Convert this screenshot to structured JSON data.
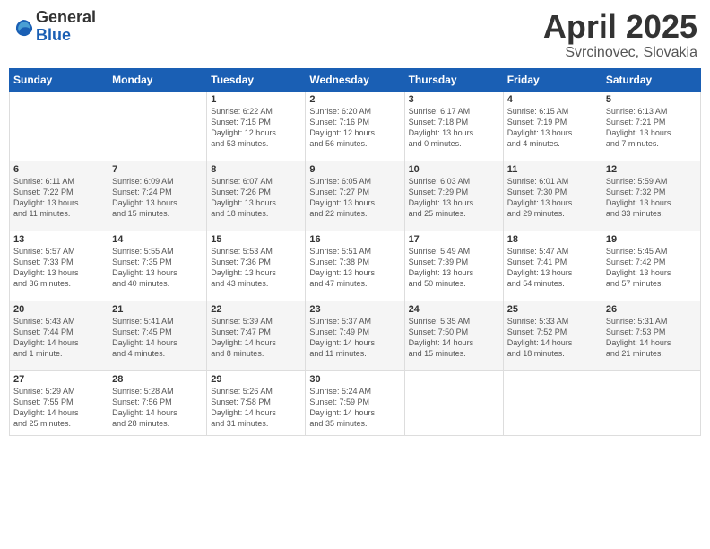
{
  "header": {
    "logo_general": "General",
    "logo_blue": "Blue",
    "month_title": "April 2025",
    "location": "Svrcinovec, Slovakia"
  },
  "weekdays": [
    "Sunday",
    "Monday",
    "Tuesday",
    "Wednesday",
    "Thursday",
    "Friday",
    "Saturday"
  ],
  "weeks": [
    [
      {
        "day": "",
        "info": ""
      },
      {
        "day": "",
        "info": ""
      },
      {
        "day": "1",
        "info": "Sunrise: 6:22 AM\nSunset: 7:15 PM\nDaylight: 12 hours\nand 53 minutes."
      },
      {
        "day": "2",
        "info": "Sunrise: 6:20 AM\nSunset: 7:16 PM\nDaylight: 12 hours\nand 56 minutes."
      },
      {
        "day": "3",
        "info": "Sunrise: 6:17 AM\nSunset: 7:18 PM\nDaylight: 13 hours\nand 0 minutes."
      },
      {
        "day": "4",
        "info": "Sunrise: 6:15 AM\nSunset: 7:19 PM\nDaylight: 13 hours\nand 4 minutes."
      },
      {
        "day": "5",
        "info": "Sunrise: 6:13 AM\nSunset: 7:21 PM\nDaylight: 13 hours\nand 7 minutes."
      }
    ],
    [
      {
        "day": "6",
        "info": "Sunrise: 6:11 AM\nSunset: 7:22 PM\nDaylight: 13 hours\nand 11 minutes."
      },
      {
        "day": "7",
        "info": "Sunrise: 6:09 AM\nSunset: 7:24 PM\nDaylight: 13 hours\nand 15 minutes."
      },
      {
        "day": "8",
        "info": "Sunrise: 6:07 AM\nSunset: 7:26 PM\nDaylight: 13 hours\nand 18 minutes."
      },
      {
        "day": "9",
        "info": "Sunrise: 6:05 AM\nSunset: 7:27 PM\nDaylight: 13 hours\nand 22 minutes."
      },
      {
        "day": "10",
        "info": "Sunrise: 6:03 AM\nSunset: 7:29 PM\nDaylight: 13 hours\nand 25 minutes."
      },
      {
        "day": "11",
        "info": "Sunrise: 6:01 AM\nSunset: 7:30 PM\nDaylight: 13 hours\nand 29 minutes."
      },
      {
        "day": "12",
        "info": "Sunrise: 5:59 AM\nSunset: 7:32 PM\nDaylight: 13 hours\nand 33 minutes."
      }
    ],
    [
      {
        "day": "13",
        "info": "Sunrise: 5:57 AM\nSunset: 7:33 PM\nDaylight: 13 hours\nand 36 minutes."
      },
      {
        "day": "14",
        "info": "Sunrise: 5:55 AM\nSunset: 7:35 PM\nDaylight: 13 hours\nand 40 minutes."
      },
      {
        "day": "15",
        "info": "Sunrise: 5:53 AM\nSunset: 7:36 PM\nDaylight: 13 hours\nand 43 minutes."
      },
      {
        "day": "16",
        "info": "Sunrise: 5:51 AM\nSunset: 7:38 PM\nDaylight: 13 hours\nand 47 minutes."
      },
      {
        "day": "17",
        "info": "Sunrise: 5:49 AM\nSunset: 7:39 PM\nDaylight: 13 hours\nand 50 minutes."
      },
      {
        "day": "18",
        "info": "Sunrise: 5:47 AM\nSunset: 7:41 PM\nDaylight: 13 hours\nand 54 minutes."
      },
      {
        "day": "19",
        "info": "Sunrise: 5:45 AM\nSunset: 7:42 PM\nDaylight: 13 hours\nand 57 minutes."
      }
    ],
    [
      {
        "day": "20",
        "info": "Sunrise: 5:43 AM\nSunset: 7:44 PM\nDaylight: 14 hours\nand 1 minute."
      },
      {
        "day": "21",
        "info": "Sunrise: 5:41 AM\nSunset: 7:45 PM\nDaylight: 14 hours\nand 4 minutes."
      },
      {
        "day": "22",
        "info": "Sunrise: 5:39 AM\nSunset: 7:47 PM\nDaylight: 14 hours\nand 8 minutes."
      },
      {
        "day": "23",
        "info": "Sunrise: 5:37 AM\nSunset: 7:49 PM\nDaylight: 14 hours\nand 11 minutes."
      },
      {
        "day": "24",
        "info": "Sunrise: 5:35 AM\nSunset: 7:50 PM\nDaylight: 14 hours\nand 15 minutes."
      },
      {
        "day": "25",
        "info": "Sunrise: 5:33 AM\nSunset: 7:52 PM\nDaylight: 14 hours\nand 18 minutes."
      },
      {
        "day": "26",
        "info": "Sunrise: 5:31 AM\nSunset: 7:53 PM\nDaylight: 14 hours\nand 21 minutes."
      }
    ],
    [
      {
        "day": "27",
        "info": "Sunrise: 5:29 AM\nSunset: 7:55 PM\nDaylight: 14 hours\nand 25 minutes."
      },
      {
        "day": "28",
        "info": "Sunrise: 5:28 AM\nSunset: 7:56 PM\nDaylight: 14 hours\nand 28 minutes."
      },
      {
        "day": "29",
        "info": "Sunrise: 5:26 AM\nSunset: 7:58 PM\nDaylight: 14 hours\nand 31 minutes."
      },
      {
        "day": "30",
        "info": "Sunrise: 5:24 AM\nSunset: 7:59 PM\nDaylight: 14 hours\nand 35 minutes."
      },
      {
        "day": "",
        "info": ""
      },
      {
        "day": "",
        "info": ""
      },
      {
        "day": "",
        "info": ""
      }
    ]
  ]
}
